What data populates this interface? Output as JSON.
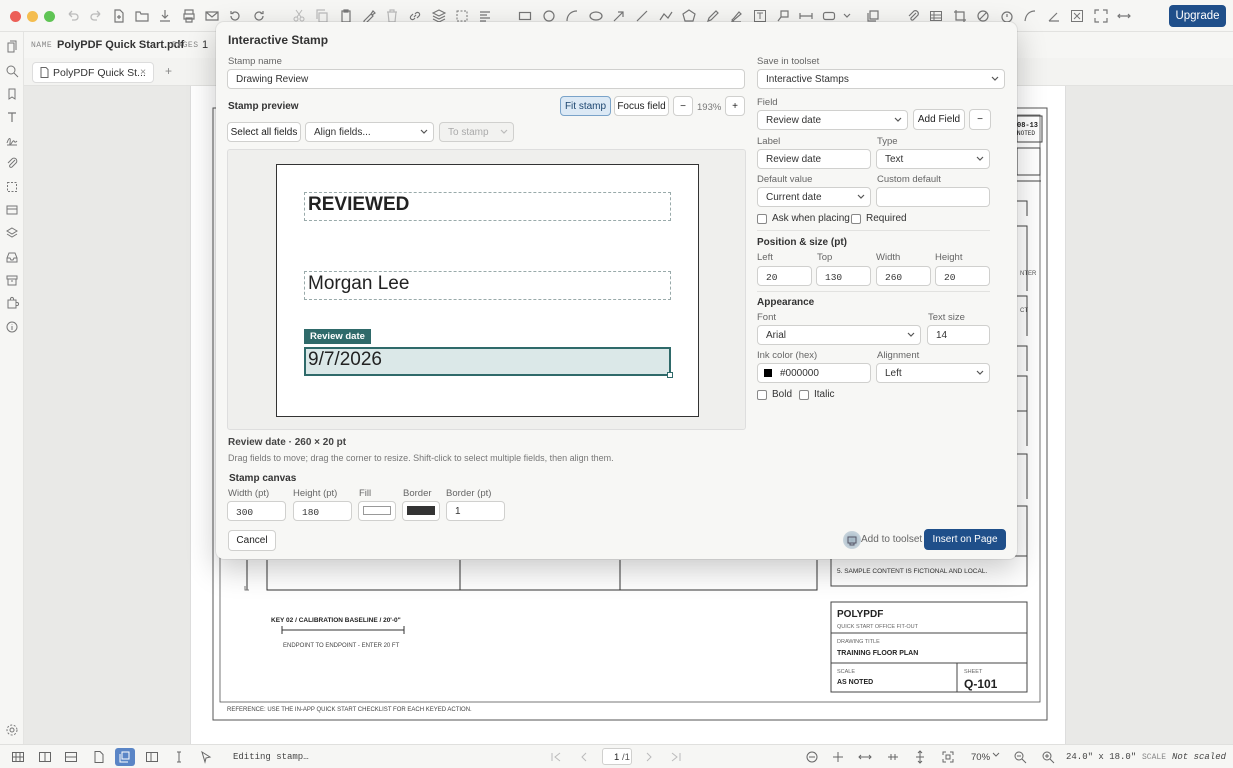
{
  "toolbar": {
    "upgrade_label": "Upgrade"
  },
  "docbar": {
    "name_key": "NAME",
    "name_value": "PolyPDF Quick Start.pdf",
    "pages_key": "PAGES",
    "pages_value": "1"
  },
  "tabbar": {
    "tab_label": "PolyPDF Quick St...",
    "close": "×",
    "add": "+"
  },
  "drawing": {
    "title_partial": "08-13",
    "title_partial2": "NOTED",
    "side_text1": "NTER",
    "side_text2": "CT",
    "note5": "5. SAMPLE CONTENT IS FICTIONAL AND LOCAL.",
    "key_title": "KEY 02 / CALIBRATION BASELINE / 20'-0\"",
    "key_sub": "ENDPOINT TO ENDPOINT - ENTER 20 FT",
    "tb_company": "POLYPDF",
    "tb_project": "QUICK START OFFICE FIT-OUT",
    "tb_drawing_key": "DRAWING TITLE",
    "tb_drawing_value": "TRAINING FLOOR PLAN",
    "tb_scale_key": "SCALE",
    "tb_scale_value": "AS NOTED",
    "tb_sheet_key": "SHEET",
    "tb_sheet_value": "Q-101",
    "reference": "REFERENCE: USE THE IN-APP QUICK START CHECKLIST FOR EACH KEYED ACTION."
  },
  "dialog": {
    "title": "Interactive Stamp",
    "stamp_name_label": "Stamp name",
    "stamp_name_value": "Drawing Review",
    "save_toolset_label": "Save in toolset",
    "save_toolset_value": "Interactive Stamps",
    "preview_label": "Stamp preview",
    "fit_stamp": "Fit stamp",
    "focus_field": "Focus field",
    "zoom_out": "−",
    "zoom_value": "193%",
    "zoom_in": "+",
    "select_all": "Select all fields",
    "align_fields": "Align fields...",
    "to_stamp": "To stamp",
    "preview_fields": {
      "reviewed": "REVIEWED",
      "name": "Morgan Lee",
      "date_tag": "Review date",
      "date": "9/7/2026"
    },
    "selection_info": "Review date · 260 × 20 pt",
    "hint": "Drag fields to move; drag the corner to resize. Shift-click to select multiple fields, then align them.",
    "canvas_label": "Stamp canvas",
    "canvas_width_label": "Width (pt)",
    "canvas_width": "300",
    "canvas_height_label": "Height (pt)",
    "canvas_height": "180",
    "fill_label": "Fill",
    "border_label": "Border",
    "border_pt_label": "Border (pt)",
    "border_pt": "1",
    "border_color": "#333333",
    "fill_color": "#ffffff",
    "cancel": "Cancel",
    "add_to_toolset": "Add to toolset",
    "insert": "Insert on Page",
    "field_label": "Field",
    "field_value": "Review date",
    "add_field": "Add Field",
    "remove_field": "−",
    "label_label": "Label",
    "label_value": "Review date",
    "type_label": "Type",
    "type_value": "Text",
    "default_label": "Default value",
    "default_value": "Current date",
    "custom_default_label": "Custom default",
    "custom_default_value": "",
    "ask_when_placing": "Ask when placing",
    "required": "Required",
    "position_section": "Position & size (pt)",
    "left_label": "Left",
    "left_value": "20",
    "top_label": "Top",
    "top_value": "130",
    "width_label": "Width",
    "width_value": "260",
    "height_label": "Height",
    "height_value": "20",
    "appearance_section": "Appearance",
    "font_label": "Font",
    "font_value": "Arial",
    "text_size_label": "Text size",
    "text_size_value": "14",
    "ink_label": "Ink color (hex)",
    "ink_value": "#000000",
    "alignment_label": "Alignment",
    "alignment_value": "Left",
    "bold": "Bold",
    "italic": "Italic",
    "accent_color": "#2f6a6a"
  },
  "statusbar": {
    "status": "Editing stamp…",
    "page_current": "1",
    "page_total": "/1",
    "zoom": "70%",
    "dimensions": "24.0\" x 18.0\"",
    "scale_key": "SCALE",
    "scale_value": "Not scaled"
  }
}
